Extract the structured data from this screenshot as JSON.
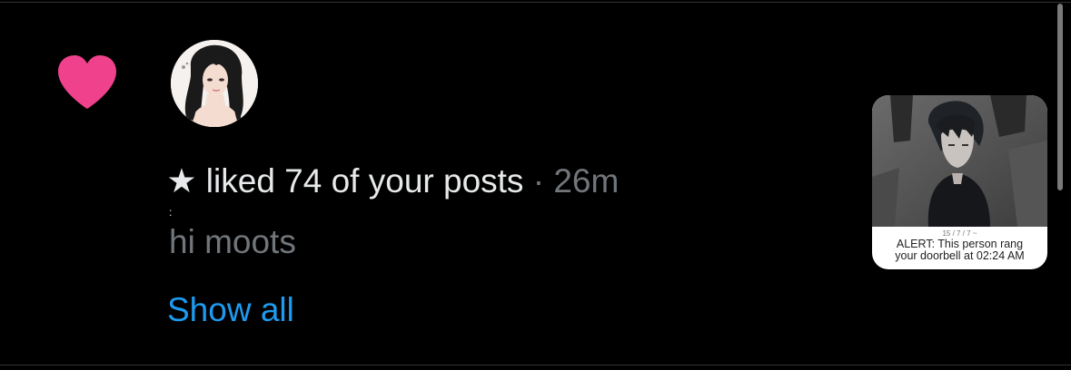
{
  "notification": {
    "type": "like",
    "actor_display_name": "★",
    "action": "liked 74 of your posts",
    "separator": "·",
    "time": "26m",
    "post_text": "hi moots",
    "show_all_label": "Show all"
  },
  "thumbnail": {
    "caption_small": "15 / 7 / 7 ~",
    "caption_line1": "ALERT: This person rang",
    "caption_line2": "your doorbell at 02:24 AM"
  },
  "colors": {
    "background": "#000000",
    "heart": "#f0418c",
    "primary_text": "#e7e9ea",
    "secondary_text": "#71767b",
    "link": "#1d9bf0",
    "divider": "#2f3336"
  },
  "icons": {
    "like": "heart-icon"
  }
}
